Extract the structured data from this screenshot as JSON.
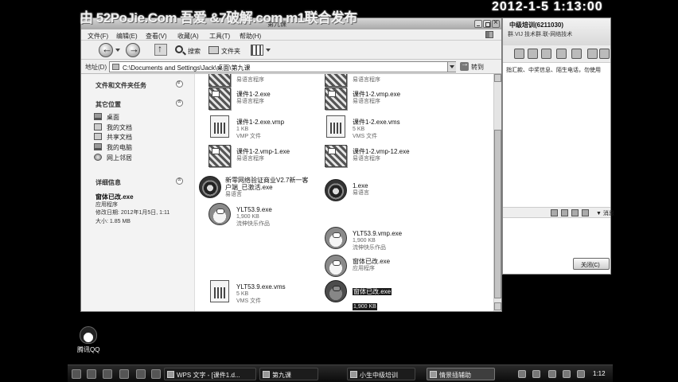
{
  "watermark": "由 52PoJie.Com 吾爱 &7破解.com m1联合发布",
  "overlay_clock": "2012-1-5 1:13:00",
  "colors": {
    "desktop": "#000000",
    "selection": "#1a1a1a",
    "window_face": "#e9e9e9"
  },
  "explorer": {
    "title": "第九课",
    "menu": [
      "文件(F)",
      "编辑(E)",
      "查看(V)",
      "收藏(A)",
      "工具(T)",
      "帮助(H)"
    ],
    "toolbar": {
      "search_label": "搜索",
      "folders_label": "文件夹"
    },
    "address": {
      "label": "地址(D)",
      "value": "C:\\Documents and Settings\\Jack\\桌面\\第九课",
      "go_label": "转到"
    },
    "task_pane": {
      "file_tasks_title": "文件和文件夹任务",
      "other_places_title": "其它位置",
      "other_places": [
        {
          "label": "桌面",
          "icon": "desktop-icon"
        },
        {
          "label": "我的文档",
          "icon": "my-documents-icon"
        },
        {
          "label": "共享文档",
          "icon": "shared-documents-icon"
        },
        {
          "label": "我的电脑",
          "icon": "my-computer-icon"
        },
        {
          "label": "网上邻居",
          "icon": "network-places-icon"
        }
      ],
      "details_title": "详细信息",
      "details": {
        "name": "窗体已改.exe",
        "type": "应用程序",
        "modified": "修改日期: 2012年1月5日, 1:11",
        "size": "大小: 1.85 MB"
      }
    },
    "files": [
      {
        "name": "",
        "type": "易语言程序",
        "icon": "easy-language-exe-icon"
      },
      {
        "name": "",
        "type": "易语言程序",
        "icon": "easy-language-exe-icon"
      },
      {
        "name": "课件1-2.exe",
        "type": "易语言程序",
        "icon": "easy-language-exe-icon"
      },
      {
        "name": "课件1-2.vmp.exe",
        "type": "易语言程序",
        "icon": "easy-language-exe-icon"
      },
      {
        "name": "课件1-2.exe.vmp",
        "size": "1 KB",
        "type": "VMP 文件",
        "icon": "vmp-file-icon"
      },
      {
        "name": "课件1-2.exe.vms",
        "size": "5 KB",
        "type": "VMS 文件",
        "icon": "vms-file-icon"
      },
      {
        "name": "课件1-2.vmp-1.exe",
        "type": "易语言程序",
        "icon": "easy-language-exe-icon"
      },
      {
        "name": "课件1-2.vmp-12.exe",
        "type": "易语言程序",
        "icon": "easy-language-exe-icon"
      },
      {
        "name": "新零网络验证商业V2.7新一客户端_已激活.exe",
        "type": "易语言",
        "icon": "round-app-icon"
      },
      {
        "name": "1.exe",
        "type": "易语言",
        "icon": "round-app-icon"
      },
      {
        "name": "YLT53.9.exe",
        "size": "1,900 KB",
        "type": "流伸快乐作品",
        "icon": "doraemon-icon"
      },
      {
        "name": "YLT53.9.vmp.exe",
        "size": "1,900 KB",
        "type": "流伸快乐作品",
        "icon": "doraemon-icon"
      },
      {
        "name": "窗体已改.exe",
        "type": "应用程序",
        "icon": "doraemon-icon"
      },
      {
        "name": "YLT53.9.exe.vms",
        "size": "5 KB",
        "type": "VMS 文件",
        "icon": "vms-file-icon"
      },
      {
        "name": "窗体已改.exe",
        "size": "1,900 KB",
        "type": "流伸快乐作品",
        "icon": "doraemon-icon"
      }
    ]
  },
  "qq_window": {
    "title": "中级培训(6211030)",
    "subtitle": "群.VIJ 技术群.联-网络技术",
    "notice": "指汇款、中奖信息、陌生电话，勿使用",
    "message_label": "▼ 消息",
    "close_label": "关闭(C)"
  },
  "desktop": {
    "qq_label": "腾讯QQ"
  },
  "taskbar": {
    "tasks": [
      {
        "label": "WPS 文字 - [课件1.d...",
        "icon": "wps-icon"
      },
      {
        "label": "第九课",
        "icon": "folder-icon"
      },
      {
        "label": "小生中级培训",
        "icon": "qq-group-icon"
      },
      {
        "label": "情景插辅助",
        "icon": "recorder-icon"
      }
    ],
    "clock": "1:12"
  }
}
